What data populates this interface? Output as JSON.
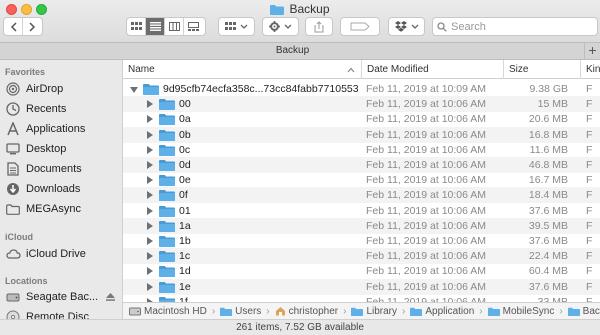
{
  "window": {
    "title": "Backup"
  },
  "toolbar": {
    "search_placeholder": "Search"
  },
  "tabbar": {
    "label": "Backup"
  },
  "sidebar": {
    "favorites_header": "Favorites",
    "favorites": [
      {
        "label": "AirDrop",
        "icon": "airdrop-icon"
      },
      {
        "label": "Recents",
        "icon": "clock-icon"
      },
      {
        "label": "Applications",
        "icon": "applications-icon"
      },
      {
        "label": "Desktop",
        "icon": "desktop-icon"
      },
      {
        "label": "Documents",
        "icon": "documents-icon"
      },
      {
        "label": "Downloads",
        "icon": "downloads-icon"
      },
      {
        "label": "MEGAsync",
        "icon": "folder-icon"
      }
    ],
    "icloud_header": "iCloud",
    "icloud": [
      {
        "label": "iCloud Drive",
        "icon": "cloud-icon"
      }
    ],
    "locations_header": "Locations",
    "locations": [
      {
        "label": "Seagate Bac...",
        "icon": "drive-icon"
      },
      {
        "label": "Remote Disc",
        "icon": "disc-icon"
      }
    ]
  },
  "columns": {
    "name": "Name",
    "date": "Date Modified",
    "size": "Size",
    "kind": "Kind"
  },
  "rows": [
    {
      "name": "9d95cfb74ecfa358c...73cc84fabb7710553",
      "date": "Feb 11, 2019 at 10:09 AM",
      "size": "9.38 GB",
      "kind": "F",
      "level": 0,
      "expanded": true
    },
    {
      "name": "00",
      "date": "Feb 11, 2019 at 10:06 AM",
      "size": "15 MB",
      "kind": "F",
      "level": 1
    },
    {
      "name": "0a",
      "date": "Feb 11, 2019 at 10:06 AM",
      "size": "20.6 MB",
      "kind": "F",
      "level": 1
    },
    {
      "name": "0b",
      "date": "Feb 11, 2019 at 10:06 AM",
      "size": "16.8 MB",
      "kind": "F",
      "level": 1
    },
    {
      "name": "0c",
      "date": "Feb 11, 2019 at 10:06 AM",
      "size": "11.6 MB",
      "kind": "F",
      "level": 1
    },
    {
      "name": "0d",
      "date": "Feb 11, 2019 at 10:06 AM",
      "size": "46.8 MB",
      "kind": "F",
      "level": 1
    },
    {
      "name": "0e",
      "date": "Feb 11, 2019 at 10:06 AM",
      "size": "16.7 MB",
      "kind": "F",
      "level": 1
    },
    {
      "name": "0f",
      "date": "Feb 11, 2019 at 10:06 AM",
      "size": "18.4 MB",
      "kind": "F",
      "level": 1
    },
    {
      "name": "01",
      "date": "Feb 11, 2019 at 10:06 AM",
      "size": "37.6 MB",
      "kind": "F",
      "level": 1
    },
    {
      "name": "1a",
      "date": "Feb 11, 2019 at 10:06 AM",
      "size": "39.5 MB",
      "kind": "F",
      "level": 1
    },
    {
      "name": "1b",
      "date": "Feb 11, 2019 at 10:06 AM",
      "size": "37.6 MB",
      "kind": "F",
      "level": 1
    },
    {
      "name": "1c",
      "date": "Feb 11, 2019 at 10:06 AM",
      "size": "22.4 MB",
      "kind": "F",
      "level": 1
    },
    {
      "name": "1d",
      "date": "Feb 11, 2019 at 10:06 AM",
      "size": "60.4 MB",
      "kind": "F",
      "level": 1
    },
    {
      "name": "1e",
      "date": "Feb 11, 2019 at 10:06 AM",
      "size": "37.6 MB",
      "kind": "F",
      "level": 1
    },
    {
      "name": "1f",
      "date": "Feb 11, 2019 at 10:06 AM",
      "size": "33 MB",
      "kind": "F",
      "level": 1
    }
  ],
  "pathbar": [
    {
      "label": "Macintosh HD",
      "icon": "hard-drive-icon"
    },
    {
      "label": "Users",
      "icon": "folder-icon"
    },
    {
      "label": "christopher",
      "icon": "home-icon"
    },
    {
      "label": "Library",
      "icon": "folder-icon"
    },
    {
      "label": "Application",
      "icon": "folder-icon"
    },
    {
      "label": "MobileSync",
      "icon": "folder-icon"
    },
    {
      "label": "Backup",
      "icon": "folder-icon"
    }
  ],
  "status": {
    "text": "261 items, 7.52 GB available"
  },
  "colors": {
    "folder": "#5fb0e6",
    "folder_dark": "#4a9bd4",
    "selected_view": "#6d6d6d"
  }
}
